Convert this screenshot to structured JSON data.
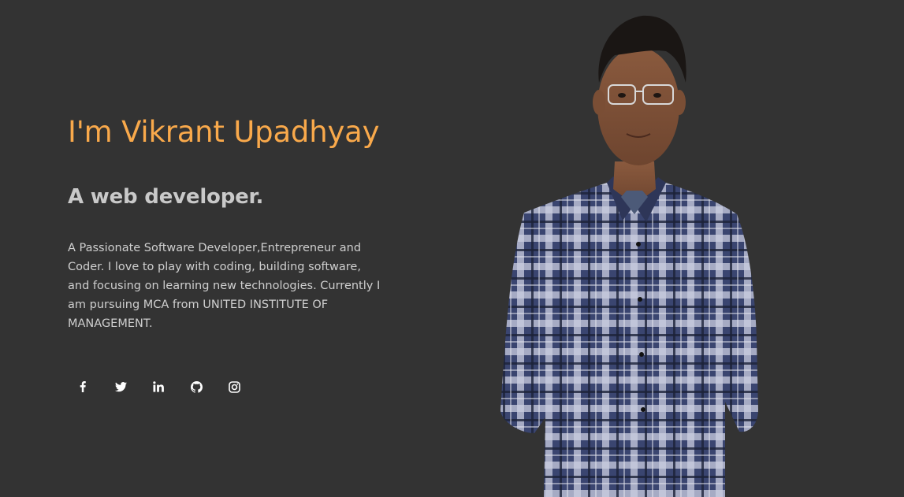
{
  "hero": {
    "name": "I'm Vikrant Upadhyay",
    "role": "A web developer.",
    "bio": "A Passionate Software Developer,Entrepreneur and Coder. I love to play with coding, building software, and focusing on learning new technologies. Currently I am pursuing MCA from UNITED INSTITUTE OF MANAGEMENT."
  },
  "social": [
    {
      "icon": "facebook-icon"
    },
    {
      "icon": "twitter-icon"
    },
    {
      "icon": "linkedin-icon"
    },
    {
      "icon": "github-icon"
    },
    {
      "icon": "instagram-icon"
    }
  ],
  "colors": {
    "background": "#333333",
    "accent": "#f9a94b",
    "heading": "#c9c9c9",
    "text": "#cfcfcf"
  }
}
